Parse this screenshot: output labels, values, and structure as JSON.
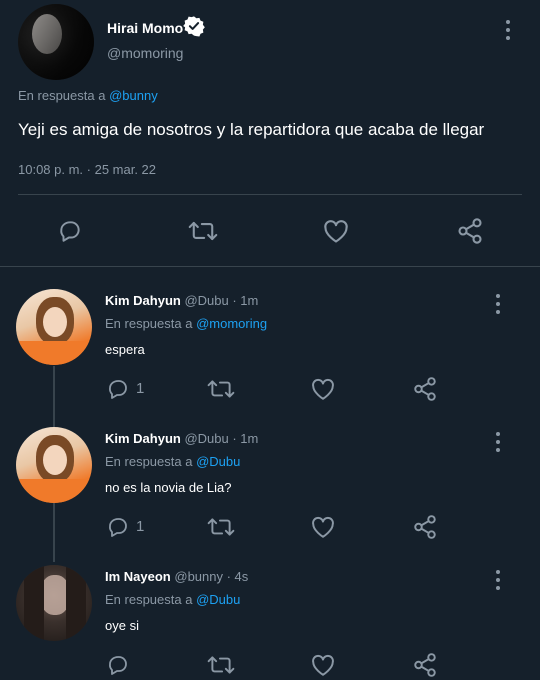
{
  "main_tweet": {
    "author_name": "Hirai Momo",
    "handle": "@momoring",
    "reply_prefix": "En respuesta a",
    "reply_to": "@bunny",
    "text": "Yeji es amiga de nosotros y la repartidora que acaba de llegar",
    "timestamp": "10:08 p. m. · 25 mar. 22"
  },
  "replies": [
    {
      "author_name": "Kim Dahyun",
      "meta": "@Dubu · 1m",
      "reply_prefix": "En respuesta a",
      "reply_to": "@momoring",
      "text": "espera",
      "reply_count": "1"
    },
    {
      "author_name": "Kim Dahyun",
      "meta": "@Dubu · 1m",
      "reply_prefix": "En respuesta a",
      "reply_to": "@Dubu",
      "text": "no es la novia de Lia?",
      "reply_count": "1"
    },
    {
      "author_name": "Im Nayeon",
      "meta": "@bunny · 4s",
      "reply_prefix": "En respuesta a",
      "reply_to": "@Dubu",
      "text": "oye si",
      "reply_count": ""
    }
  ],
  "colors": {
    "background": "#15202b",
    "muted": "#8b98a5",
    "link": "#1da1f2",
    "divider": "#38444d"
  },
  "icons": [
    "verified-badge-icon",
    "more-options-icon",
    "reply-icon",
    "retweet-icon",
    "like-icon",
    "share-icon"
  ]
}
